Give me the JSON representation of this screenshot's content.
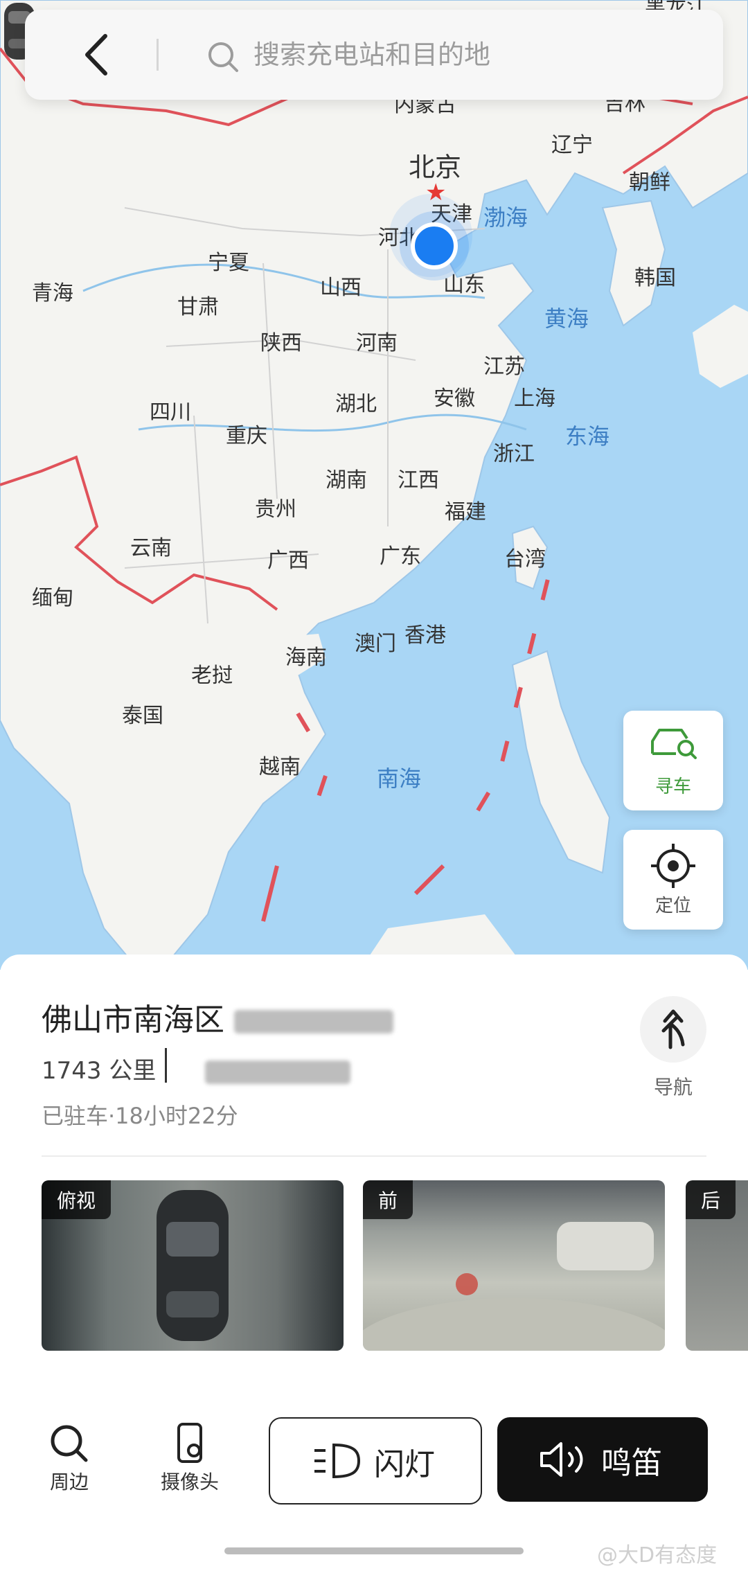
{
  "search": {
    "back_icon": "chevron-left-icon",
    "search_icon": "search-icon",
    "placeholder": "搜索充电站和目的地"
  },
  "map": {
    "provinces": [
      "北京",
      "天津",
      "河北",
      "山西",
      "山东",
      "宁夏",
      "甘肃",
      "青海",
      "陕西",
      "河南",
      "江苏",
      "安徽",
      "上海",
      "湖北",
      "四川",
      "重庆",
      "浙江",
      "湖南",
      "江西",
      "福建",
      "贵州",
      "云南",
      "广西",
      "广东",
      "台湾",
      "香港",
      "澳门",
      "海南",
      "内蒙古",
      "辽宁",
      "吉林",
      "黑龙江"
    ],
    "countries": [
      "朝鲜",
      "韩国",
      "缅甸",
      "老挝",
      "泰国",
      "越南"
    ],
    "seas": [
      "渤海",
      "黄海",
      "东海",
      "南海"
    ]
  },
  "floating": {
    "find_car": {
      "label": "寻车",
      "icon": "car-search-icon"
    },
    "locate": {
      "label": "定位",
      "icon": "crosshair-icon"
    }
  },
  "vehicle": {
    "address": "佛山市南海区",
    "distance": "1743 公里",
    "parked_status": "已驻车·18小时22分",
    "navigate_label": "导航",
    "navigate_icon": "turn-arrow-icon"
  },
  "cameras": [
    {
      "tag": "俯视"
    },
    {
      "tag": "前"
    },
    {
      "tag": "后"
    }
  ],
  "actions": {
    "nearby": {
      "label": "周边",
      "icon": "search-icon"
    },
    "camera": {
      "label": "摄像头",
      "icon": "phone-camera-icon"
    },
    "flash": {
      "label": "闪灯",
      "icon": "headlight-icon"
    },
    "horn": {
      "label": "鸣笛",
      "icon": "speaker-icon"
    }
  },
  "watermark": "@大D有态度",
  "colors": {
    "accent_green": "#3e9a3a",
    "location_blue": "#1a7df2",
    "sea": "#a9d6f5",
    "land": "#f4f4f1",
    "border_red": "#e0525a"
  }
}
